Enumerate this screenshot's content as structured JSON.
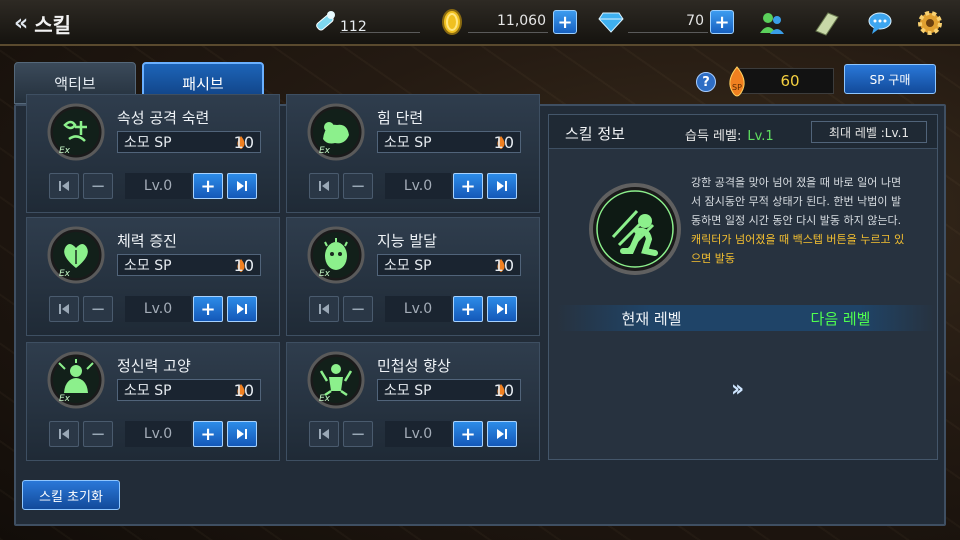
{
  "header": {
    "title": "스킬",
    "stamina": "112",
    "gold": "11,060",
    "gems": "70"
  },
  "tabs": {
    "active_skill": "액티브",
    "passive_skill": "패시브"
  },
  "sp": {
    "value": "60",
    "buy_label": "SP 구매",
    "help": "?"
  },
  "skills": [
    {
      "name": "속성 공격 숙련",
      "cost_label": "소모 SP",
      "cost": "10",
      "level": "Lv.0"
    },
    {
      "name": "힘 단련",
      "cost_label": "소모 SP",
      "cost": "10",
      "level": "Lv.0"
    },
    {
      "name": "체력 증진",
      "cost_label": "소모 SP",
      "cost": "10",
      "level": "Lv.0"
    },
    {
      "name": "지능 발달",
      "cost_label": "소모 SP",
      "cost": "10",
      "level": "Lv.0"
    },
    {
      "name": "정신력 고양",
      "cost_label": "소모 SP",
      "cost": "10",
      "level": "Lv.0"
    },
    {
      "name": "민첩성 향상",
      "cost_label": "소모 SP",
      "cost": "10",
      "level": "Lv.0"
    }
  ],
  "info": {
    "title": "스킬 정보",
    "acquire_label": "습득 레벨:",
    "acquire_value": "Lv.1",
    "max_level": "최대 레벨 :Lv.1",
    "desc_lines": [
      "강한 공격을 맞아 넘어 졌을 때 바로 일어 나면",
      "서 잠시동안 무적 상태가 된다. 한번 낙법이 발",
      "동하면 일정 시간 동안 다시 발동 하지 않는다."
    ],
    "desc_highlight_lines": [
      "캐릭터가 넘어졌을 때 백스텝 버튼을 누르고 있",
      "으면 발동"
    ],
    "current_level": "현재 레벨",
    "next_level": "다음 레벨"
  },
  "footer": {
    "reset_label": "스킬 초기화"
  },
  "colors": {
    "accent_blue": "#1d64b8",
    "skill_green": "#8cf08c",
    "sp_gold": "#f5d040",
    "next_green": "#4fff4f"
  },
  "icons": [
    "back-chevron-icon",
    "stamina-icon",
    "gold-coin-icon",
    "gem-icon",
    "friends-icon",
    "notebook-icon",
    "chat-icon",
    "settings-gear-icon",
    "sp-flame-icon"
  ]
}
